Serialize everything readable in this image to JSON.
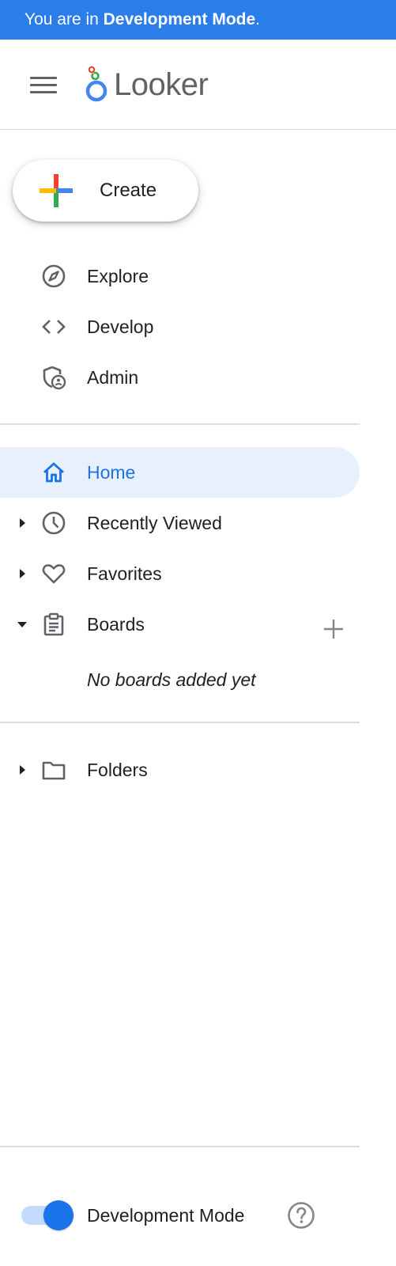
{
  "banner": {
    "prefix": "You are in ",
    "mode": "Development Mode",
    "suffix": "."
  },
  "app": {
    "brand": "Looker",
    "icons": {
      "menu": "hamburger-menu-icon",
      "logo": "looker-logo-icon"
    }
  },
  "create_button": {
    "label": "Create",
    "icon": "multicolor-plus-icon"
  },
  "primary_nav": [
    {
      "label": "Explore",
      "icon": "compass-icon"
    },
    {
      "label": "Develop",
      "icon": "code-brackets-icon"
    },
    {
      "label": "Admin",
      "icon": "admin-shield-icon"
    }
  ],
  "secondary_nav": {
    "home": {
      "label": "Home",
      "icon": "home-icon",
      "active": true
    },
    "recently_viewed": {
      "label": "Recently Viewed",
      "icon": "clock-icon",
      "expanded": false
    },
    "favorites": {
      "label": "Favorites",
      "icon": "heart-icon",
      "expanded": false
    },
    "boards": {
      "label": "Boards",
      "icon": "clipboard-icon",
      "expanded": true,
      "empty_text": "No boards added yet",
      "add_icon": "plus-icon"
    }
  },
  "folders": {
    "label": "Folders",
    "icon": "folder-icon",
    "expanded": false
  },
  "footer": {
    "dev_mode_label": "Development Mode",
    "dev_mode_enabled": true,
    "help_icon": "help-circle-icon"
  },
  "colors": {
    "banner": "#2b7de9",
    "accent": "#1a73e8",
    "active_bg": "#e8f0fe",
    "icon_gray": "#5f6368",
    "divider": "#dadce0"
  }
}
